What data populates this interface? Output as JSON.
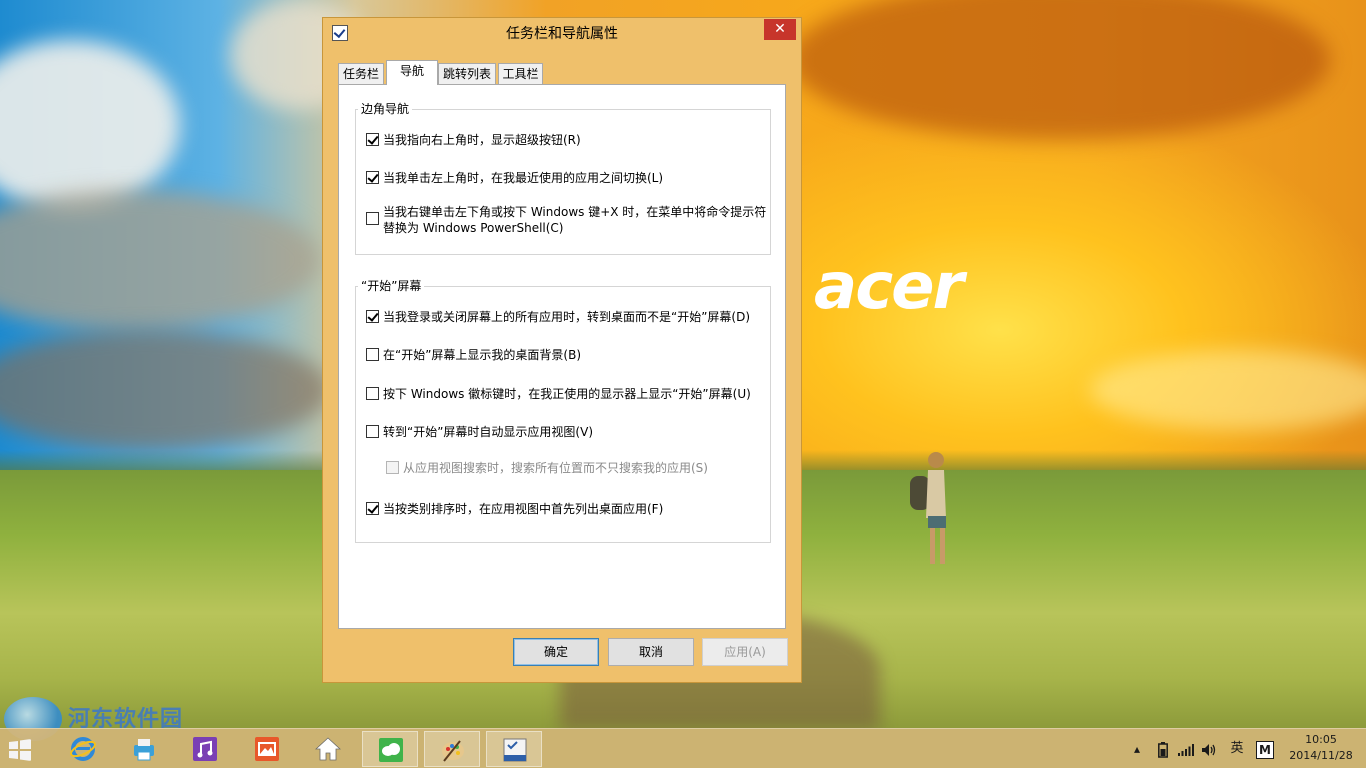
{
  "desktop": {
    "brand_logo": "acer",
    "watermark_text": "河东软件园"
  },
  "dialog": {
    "title": "任务栏和导航属性",
    "close_glyph": "✕",
    "tabs": [
      {
        "label": "任务栏",
        "active": false
      },
      {
        "label": "导航",
        "active": true
      },
      {
        "label": "跳转列表",
        "active": false
      },
      {
        "label": "工具栏",
        "active": false
      }
    ],
    "corner_group": {
      "label": "边角导航",
      "options": [
        {
          "label": "当我指向右上角时，显示超级按钮(R)",
          "checked": true,
          "enabled": true
        },
        {
          "label": "当我单击左上角时，在我最近使用的应用之间切换(L)",
          "checked": true,
          "enabled": true
        },
        {
          "label_line1": "当我右键单击左下角或按下 Windows 键+X 时，在菜单中将命令提示符",
          "label_line2": "替换为 Windows PowerShell(C)",
          "checked": false,
          "enabled": true
        }
      ]
    },
    "start_group": {
      "label": "“开始”屏幕",
      "options": [
        {
          "label": "当我登录或关闭屏幕上的所有应用时，转到桌面而不是“开始”屏幕(D)",
          "checked": true,
          "enabled": true
        },
        {
          "label": "在“开始”屏幕上显示我的桌面背景(B)",
          "checked": false,
          "enabled": true
        },
        {
          "label": "按下 Windows 徽标键时，在我正使用的显示器上显示“开始”屏幕(U)",
          "checked": false,
          "enabled": true
        },
        {
          "label": "转到“开始”屏幕时自动显示应用视图(V)",
          "checked": false,
          "enabled": true
        },
        {
          "label": "从应用视图搜索时，搜索所有位置而不只搜索我的应用(S)",
          "checked": false,
          "enabled": false
        },
        {
          "label": "当按类别排序时，在应用视图中首先列出桌面应用(F)",
          "checked": true,
          "enabled": true
        }
      ]
    },
    "buttons": {
      "ok": "确定",
      "cancel": "取消",
      "apply": "应用(A)"
    }
  },
  "taskbar": {
    "apps": [
      {
        "name": "start-icon",
        "color": "#f0f0f0"
      },
      {
        "name": "internet-explorer-icon",
        "color": "#2f89d8"
      },
      {
        "name": "printer-app-icon",
        "color": "#3aa0d8"
      },
      {
        "name": "media-app-icon",
        "color": "#7a3fb4"
      },
      {
        "name": "photos-app-icon",
        "color": "#e8582a"
      },
      {
        "name": "home-icon",
        "color": "#ffffff"
      },
      {
        "name": "cloud-app-icon",
        "color": "#3fb34a"
      },
      {
        "name": "paint-app-icon",
        "color": "#c6a26b"
      },
      {
        "name": "taskbar-properties-icon",
        "color": "#2d5fa8"
      }
    ],
    "tray": {
      "ime_label": "英",
      "ime_mode": "M"
    },
    "clock": {
      "time": "10:05",
      "date": "2014/11/28"
    }
  }
}
